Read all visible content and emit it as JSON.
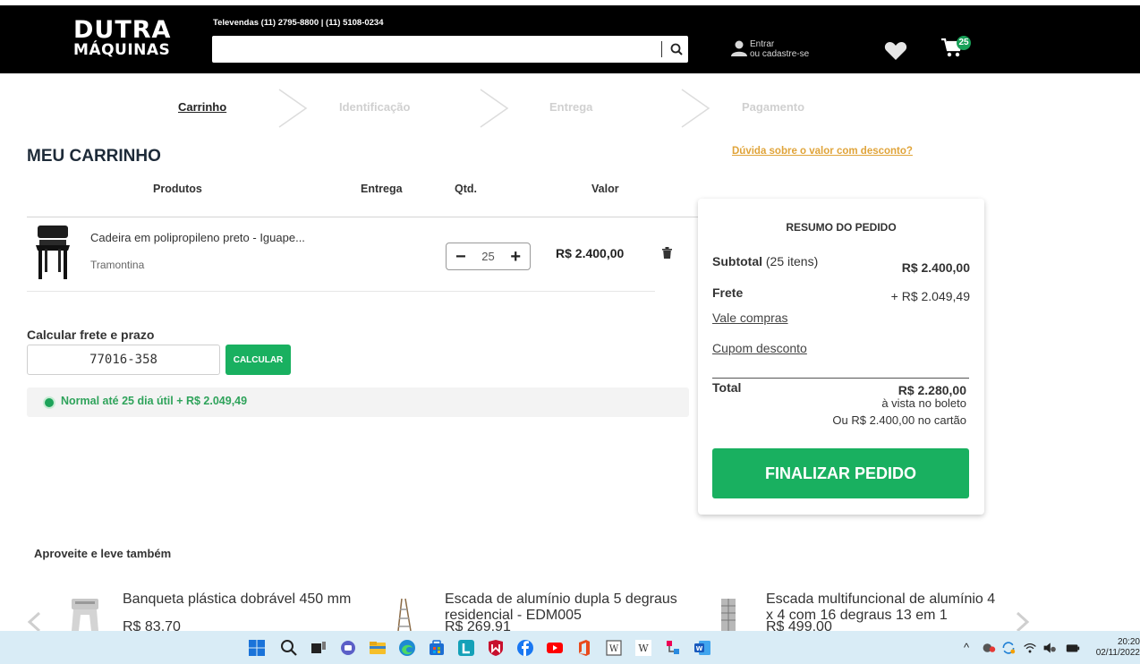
{
  "header": {
    "logo_line1": "DUTRA",
    "logo_line2": "MÁQUINAS",
    "televendas": "Televendas (11) 2795-8800  |  (11) 5108-0234",
    "search_value": "",
    "account_line1": "Entrar",
    "account_line2": "ou cadastre-se",
    "cart_count": "25"
  },
  "steps": [
    {
      "label": "Carrinho",
      "active": true
    },
    {
      "label": "Identificação",
      "active": false
    },
    {
      "label": "Entrega",
      "active": false
    },
    {
      "label": "Pagamento",
      "active": false
    }
  ],
  "cart": {
    "title": "MEU CARRINHO",
    "discount_link": "Dúvida sobre o valor com desconto?",
    "columns": {
      "produtos": "Produtos",
      "entrega": "Entrega",
      "qtd": "Qtd.",
      "valor": "Valor"
    },
    "items": [
      {
        "name": "Cadeira em polipropileno preto - Iguape...",
        "brand": "Tramontina",
        "qty": "25",
        "price": "R$ 2.400,00"
      }
    ]
  },
  "shipping": {
    "label": "Calcular frete e prazo",
    "cep": "77016-358",
    "button": "CALCULAR",
    "option": "Normal  até 25 dia útil  + R$ 2.049,49"
  },
  "summary": {
    "title": "RESUMO DO PEDIDO",
    "subtotal_label": "Subtotal",
    "subtotal_items": "(25 itens)",
    "subtotal_value": "R$ 2.400,00",
    "frete_label": "Frete",
    "frete_value": "+ R$ 2.049,49",
    "vale": "Vale compras",
    "cupom": "Cupom desconto",
    "total_label": "Total",
    "total_value": "R$ 2.280,00",
    "total_sub": "à vista no boleto",
    "card_text": "Ou R$ 2.400,00 no cartão",
    "finalizar": "FINALIZAR PEDIDO"
  },
  "recommendations": {
    "title": "Aproveite e leve também",
    "items": [
      {
        "name": "Banqueta plástica dobrável 450 mm",
        "price": "R$ 83,70"
      },
      {
        "name": "Escada de alumínio dupla 5 degraus residencial - EDM005",
        "price": "R$ 269,91"
      },
      {
        "name": "Escada multifuncional de alumínio 4 x 4 com 16 degraus 13 em 1",
        "price": "R$ 499,00"
      }
    ]
  },
  "taskbar": {
    "time": "20:20",
    "date": "02/11/2022"
  },
  "colors": {
    "brand_green": "#19b060",
    "discount_link": "#e0a43a",
    "header_bg": "#000000"
  }
}
